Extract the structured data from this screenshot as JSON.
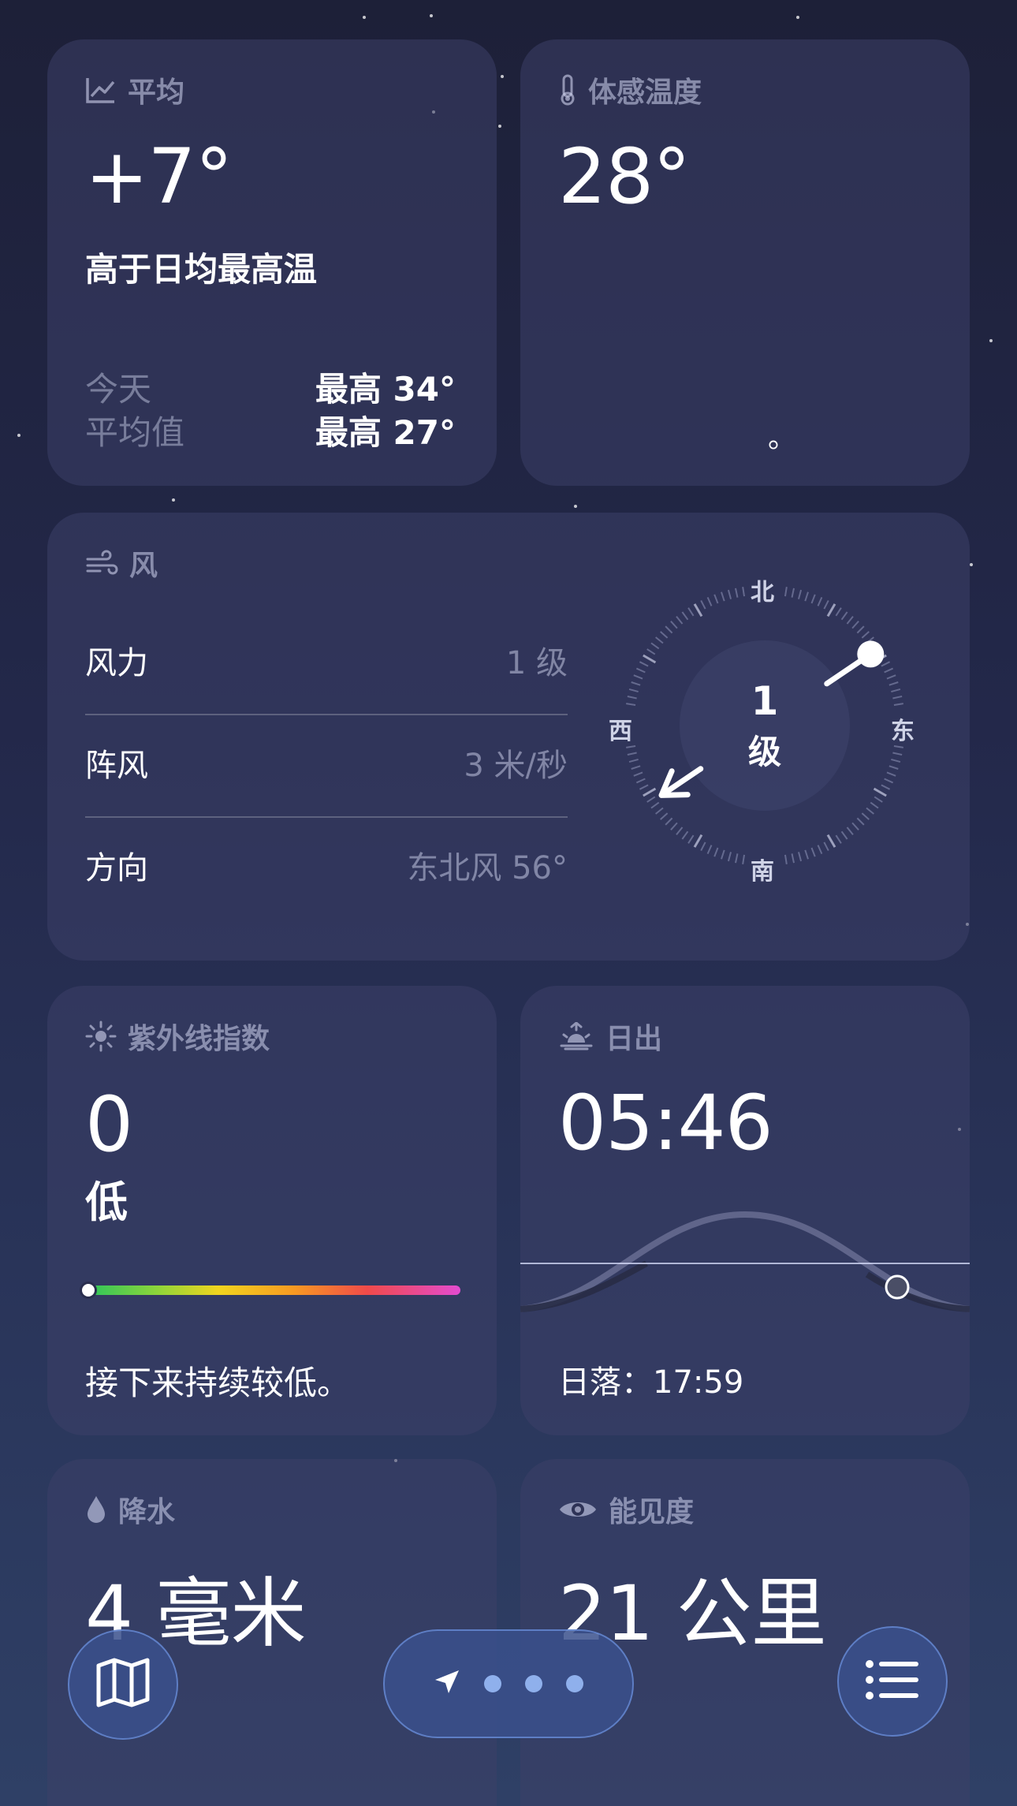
{
  "average": {
    "title": "平均",
    "value": "+7°",
    "description": "高于日均最高温",
    "rows": [
      {
        "label": "今天",
        "value": "最高 34°"
      },
      {
        "label": "平均值",
        "value": "最高 27°"
      }
    ]
  },
  "feels_like": {
    "title": "体感温度",
    "value": "28°",
    "note": "。"
  },
  "wind": {
    "title": "风",
    "rows": [
      {
        "label": "风力",
        "value": "1 级"
      },
      {
        "label": "阵风",
        "value": "3 米/秒"
      },
      {
        "label": "方向",
        "value": "东北风 56°"
      }
    ],
    "compass": {
      "north": "北",
      "south": "南",
      "east": "东",
      "west": "西",
      "level_number": "1",
      "level_unit": "级",
      "direction_degrees": 56
    }
  },
  "uv": {
    "title": "紫外线指数",
    "value": "0",
    "level": "低",
    "description": "接下来持续较低。",
    "bar_position": 0.0
  },
  "sunrise": {
    "title": "日出",
    "time": "05:46",
    "sunset": "日落：17:59"
  },
  "precipitation": {
    "title": "降水",
    "value": "4 毫米"
  },
  "visibility": {
    "title": "能见度",
    "value": "21 公里"
  },
  "toolbar": {
    "map_icon": "map-icon",
    "location_icon": "location-arrow-icon",
    "list_icon": "list-icon",
    "page_dots": 3
  }
}
